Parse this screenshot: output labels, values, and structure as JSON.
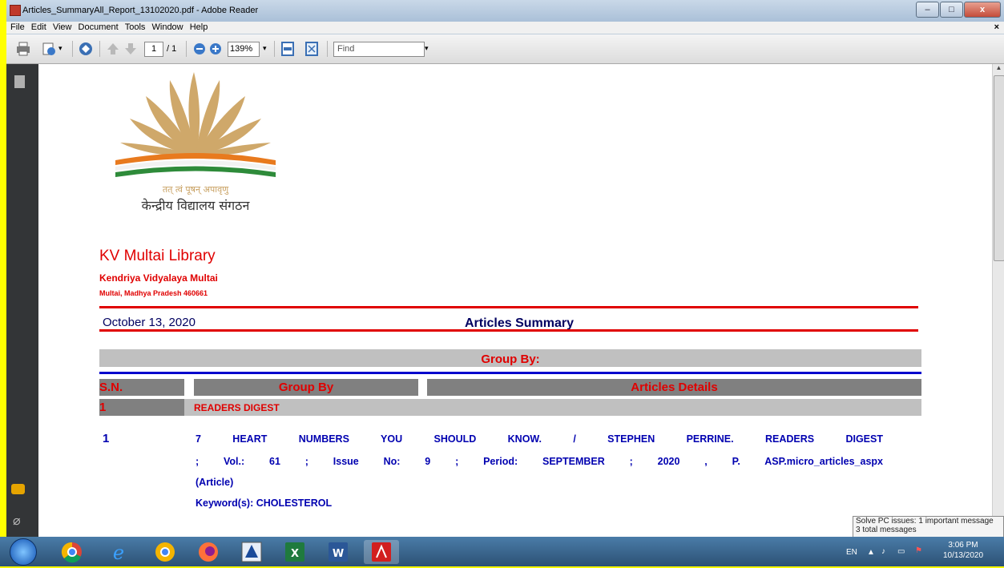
{
  "window": {
    "title": "Articles_SummaryAll_Report_13102020.pdf - Adobe Reader",
    "minimize_glyph": "–",
    "maximize_glyph": "□",
    "close_glyph": "x"
  },
  "menubar": {
    "items": [
      "File",
      "Edit",
      "View",
      "Document",
      "Tools",
      "Window",
      "Help"
    ],
    "close_glyph": "×"
  },
  "toolbar": {
    "page_current": "1",
    "page_total": "/ 1",
    "zoom": "139%",
    "find_placeholder": "Find"
  },
  "logo": {
    "motto": "तत् त्वं पूषन् अपावृणु",
    "name": "केन्द्रीय विद्यालय संगठन"
  },
  "report": {
    "org_name": "KV Multai Library",
    "school": "Kendriya Vidyalaya Multai",
    "address": "Multai, Madhya Pradesh 460661",
    "date": "October 13, 2020",
    "title": "Articles Summary",
    "group_by_bar": "Group By:",
    "headers": {
      "sn": "S.N.",
      "group_by": "Group By",
      "details": "Articles Details"
    },
    "group": {
      "number": "1",
      "name": "READERS DIGEST"
    },
    "item": {
      "number": "1",
      "line1": "7 HEART NUMBERS YOU SHOULD KNOW. / STEPHEN PERRINE. READERS DIGEST",
      "line2": "; Vol.: 61 ; Issue No: 9 ; Period: SEPTEMBER ; 2020 , P. ASP.micro_articles_aspx",
      "line3": "(Article)",
      "keywords": "Keyword(s): CHOLESTEROL"
    }
  },
  "notification": {
    "line1": "Solve PC issues: 1 important message",
    "line2": "3 total messages"
  },
  "taskbar": {
    "language": "EN",
    "time": "3:06 PM",
    "date": "10/13/2020"
  }
}
